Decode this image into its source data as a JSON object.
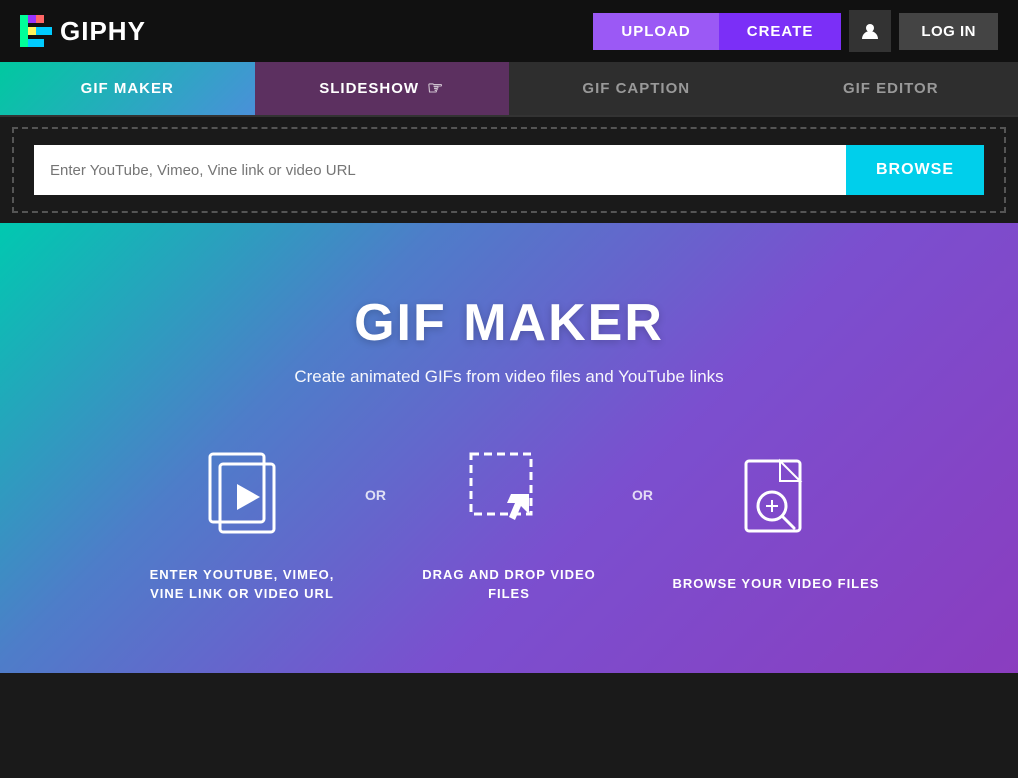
{
  "header": {
    "logo_text": "GIPHY",
    "upload_label": "UPLOAD",
    "create_label": "CREATE",
    "login_label": "LOG IN"
  },
  "tabs": [
    {
      "id": "gif-maker",
      "label": "GIF MAKER",
      "state": "active-gif"
    },
    {
      "id": "slideshow",
      "label": "SLIDESHOW",
      "state": "active-slideshow"
    },
    {
      "id": "gif-caption",
      "label": "GIF CAPTION",
      "state": "inactive"
    },
    {
      "id": "gif-editor",
      "label": "GIF EDITOR",
      "state": "inactive"
    }
  ],
  "url_section": {
    "placeholder": "Enter YouTube, Vimeo, Vine link or video URL",
    "browse_label": "BROWSE"
  },
  "hero": {
    "title": "GIF MAKER",
    "subtitle": "Create animated GIFs from video files and YouTube links",
    "options": [
      {
        "id": "enter-url",
        "label": "ENTER YOUTUBE, VIMEO,\nVINE LINK OR VIDEO URL"
      },
      {
        "id": "drag-drop",
        "label": "DRAG AND DROP VIDEO\nFILES"
      },
      {
        "id": "browse-files",
        "label": "BROWSE YOUR VIDEO FILES"
      }
    ],
    "or_label": "OR"
  }
}
